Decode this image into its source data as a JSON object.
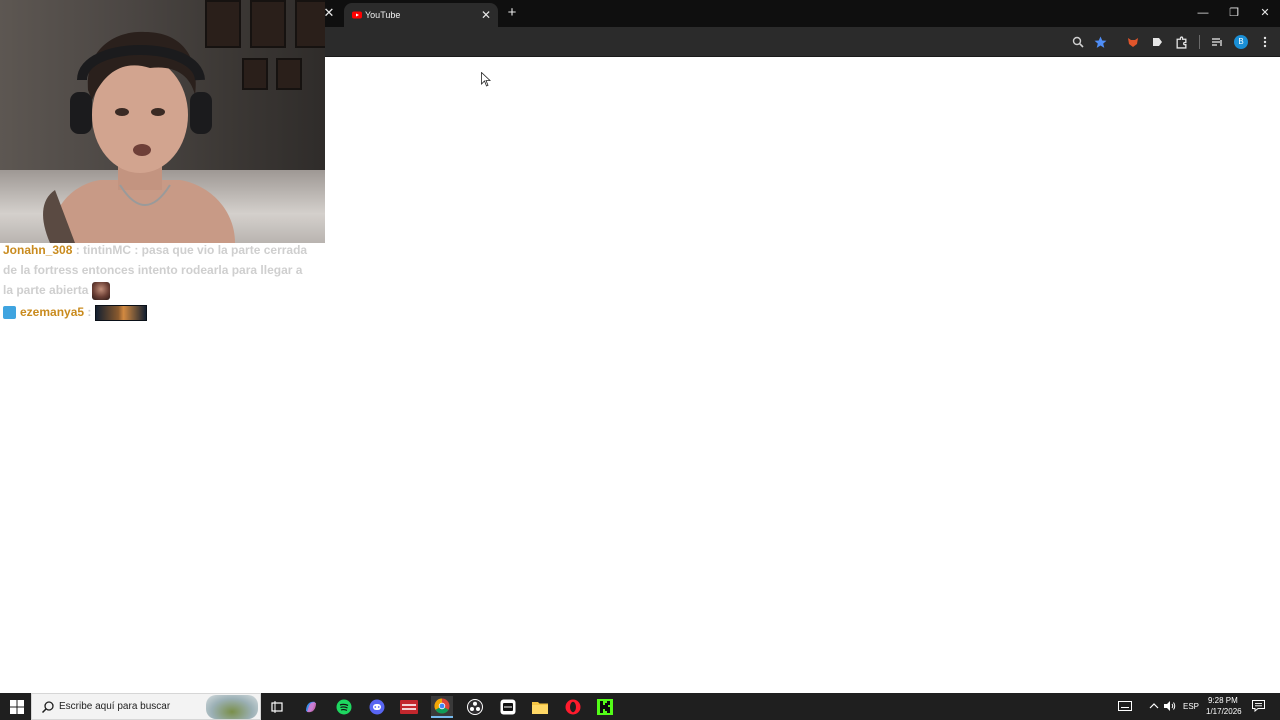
{
  "browser": {
    "tab_title": "YouTube",
    "avatar_letter": "B"
  },
  "chat": {
    "line1_user": "Jonahn_308",
    "line1_text": " : tintinMC : pasa que vio la parte cerrada de la fortress entonces intento rodearla para llegar a la parte abierta",
    "line2_user": "ezemanya5",
    "line2_sep": " : "
  },
  "taskbar": {
    "search_placeholder": "Escribe aquí para buscar",
    "language": "ESP",
    "time": "9:28 PM",
    "date": "1/17/2026"
  },
  "colors": {
    "chat_user": "#c98b1e",
    "youtube_red": "#ff0000",
    "bookmark_star": "#4f8ef7",
    "avatar": "#1a8fd6"
  }
}
